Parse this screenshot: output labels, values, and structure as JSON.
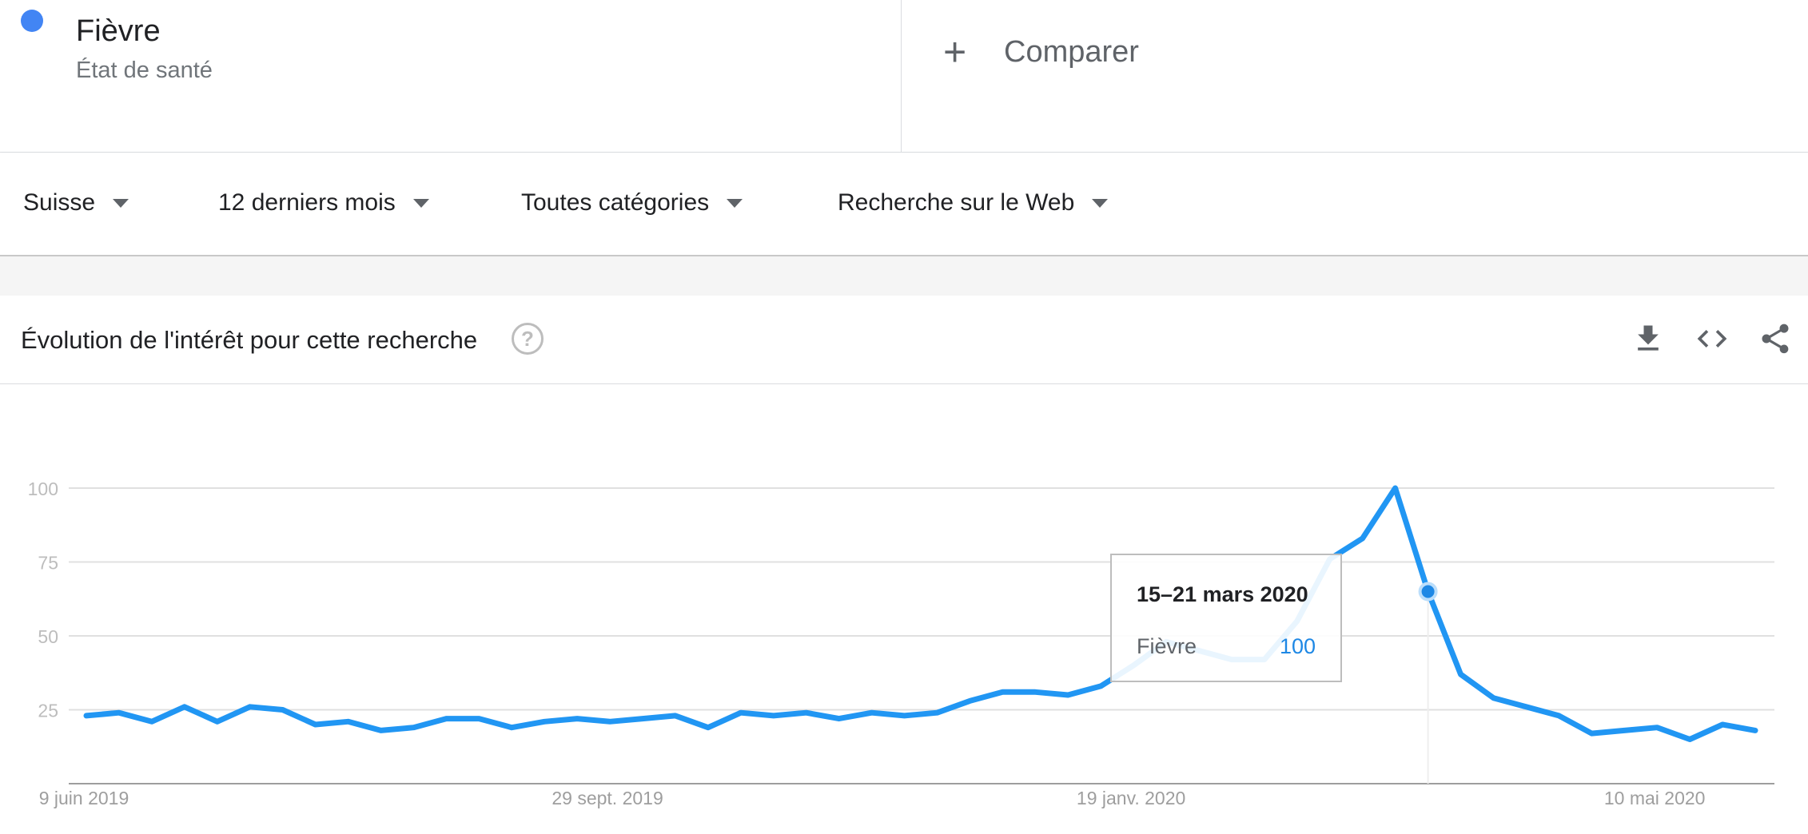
{
  "term": {
    "name": "Fièvre",
    "type": "État de santé",
    "color": "#4285f4"
  },
  "compare": {
    "plus_icon": "plus-icon",
    "label": "Comparer"
  },
  "filters": [
    {
      "label": "Suisse"
    },
    {
      "label": "12 derniers mois"
    },
    {
      "label": "Toutes catégories"
    },
    {
      "label": "Recherche sur le Web"
    }
  ],
  "panel": {
    "title": "Évolution de l'intérêt pour cette recherche",
    "help_icon": "question-icon",
    "help_glyph": "?",
    "download_icon": "download-icon",
    "embed_icon": "embed-code-icon",
    "share_icon": "share-icon"
  },
  "tooltip": {
    "date": "15–21 mars 2020",
    "series": "Fièvre",
    "value": "100"
  },
  "chart_data": {
    "type": "line",
    "title": "",
    "xlabel": "",
    "ylabel": "",
    "ylim": [
      0,
      100
    ],
    "yticks": [
      25,
      50,
      75,
      100
    ],
    "grid": true,
    "x_tick_labels": [
      "9 juin 2019",
      "29 sept. 2019",
      "19 janv. 2020",
      "10 mai 2020"
    ],
    "x_tick_indices": [
      0,
      16,
      32,
      48
    ],
    "highlight_index": 41,
    "series": [
      {
        "name": "Fièvre",
        "color": "#2196f3",
        "values": [
          23,
          24,
          21,
          26,
          21,
          26,
          25,
          20,
          21,
          18,
          19,
          22,
          22,
          19,
          21,
          22,
          21,
          22,
          23,
          19,
          24,
          23,
          24,
          22,
          24,
          23,
          24,
          28,
          31,
          31,
          30,
          33,
          40,
          48,
          45,
          42,
          42,
          55,
          76,
          83,
          100,
          65,
          37,
          29,
          26,
          23,
          17,
          18,
          19,
          15,
          20,
          18
        ]
      }
    ]
  }
}
